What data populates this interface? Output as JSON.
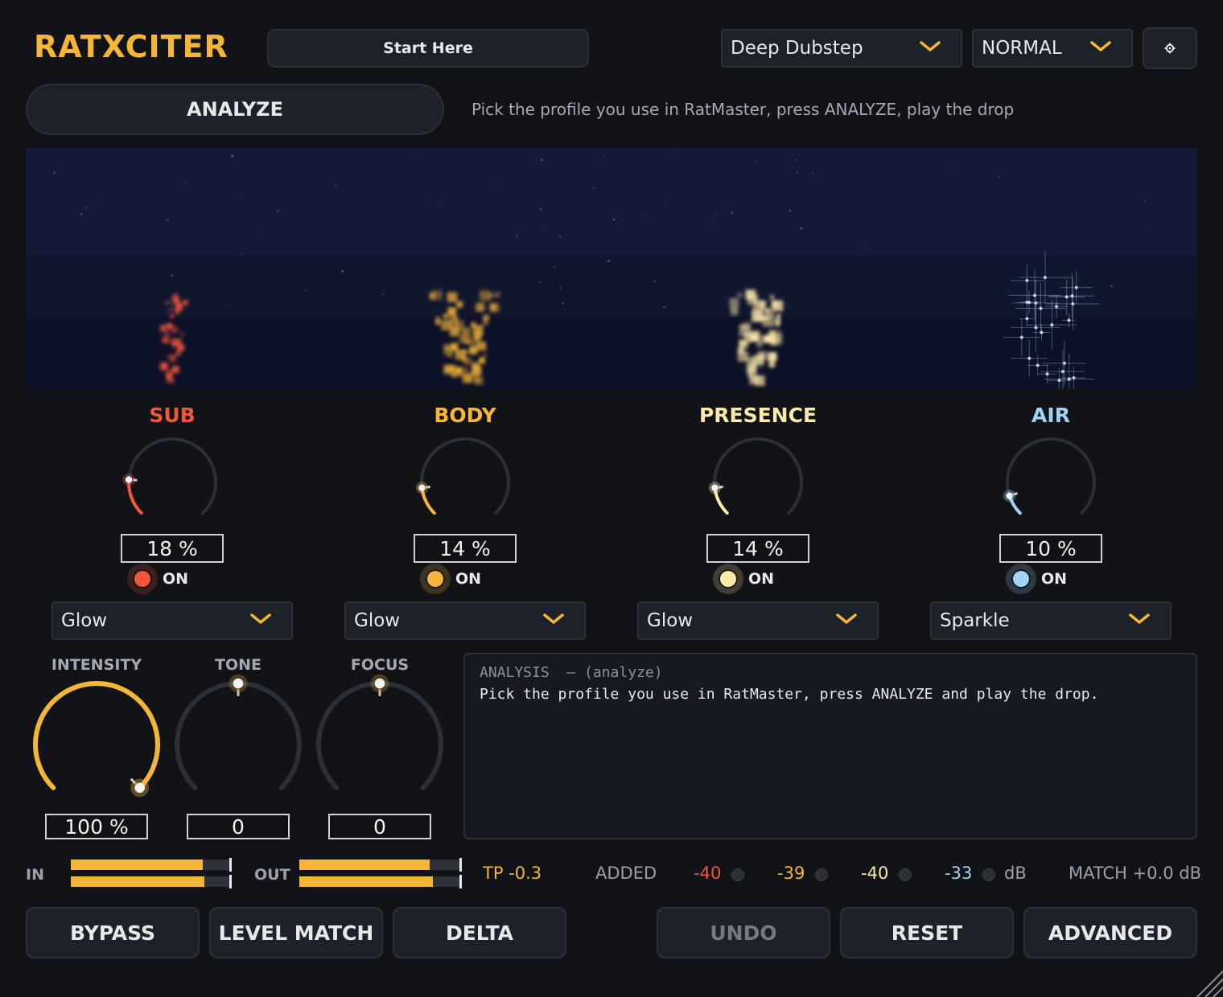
{
  "header": {
    "logo": "RATXCITER",
    "start_label": "Start Here",
    "preset": "Deep Dubstep",
    "mode": "NORMAL",
    "settings_icon": "gear-icon"
  },
  "analyze": {
    "button_label": "ANALYZE",
    "hint": "Pick the profile you use in RatMaster, press ANALYZE, play the drop"
  },
  "colors": {
    "accent": "#f5b535",
    "sub": "#f2573a",
    "body": "#f7b53a",
    "presence": "#fde9a8",
    "air": "#9fd4f7"
  },
  "bands": [
    {
      "name": "SUB",
      "value": "18 %",
      "amount": 0.18,
      "on_label": "ON",
      "mode": "Glow"
    },
    {
      "name": "BODY",
      "value": "14 %",
      "amount": 0.14,
      "on_label": "ON",
      "mode": "Glow"
    },
    {
      "name": "PRESENCE",
      "value": "14 %",
      "amount": 0.14,
      "on_label": "ON",
      "mode": "Glow"
    },
    {
      "name": "AIR",
      "value": "10 %",
      "amount": 0.1,
      "on_label": "ON",
      "mode": "Sparkle"
    }
  ],
  "macros": [
    {
      "label": "INTENSITY",
      "value": "100 %",
      "amount": 1.0
    },
    {
      "label": "TONE",
      "value": "0",
      "amount": 0.5
    },
    {
      "label": "FOCUS",
      "value": "0",
      "amount": 0.5
    }
  ],
  "analysis": {
    "heading": "ANALYSIS  — (analyze)",
    "text": "Pick the profile you use in RatMaster, press ANALYZE and play the drop."
  },
  "meters": {
    "in_label": "IN",
    "out_label": "OUT",
    "in_levels": [
      0.82,
      0.83
    ],
    "out_levels": [
      0.8,
      0.82
    ],
    "tp": "TP -0.3",
    "added_label": "ADDED",
    "added": [
      "-40",
      "-39",
      "-40",
      "-33"
    ],
    "db_label": "dB",
    "match": "MATCH +0.0 dB"
  },
  "footer": {
    "bypass": "BYPASS",
    "level_match": "LEVEL MATCH",
    "delta": "DELTA",
    "undo": "UNDO",
    "reset": "RESET",
    "advanced": "ADVANCED"
  }
}
